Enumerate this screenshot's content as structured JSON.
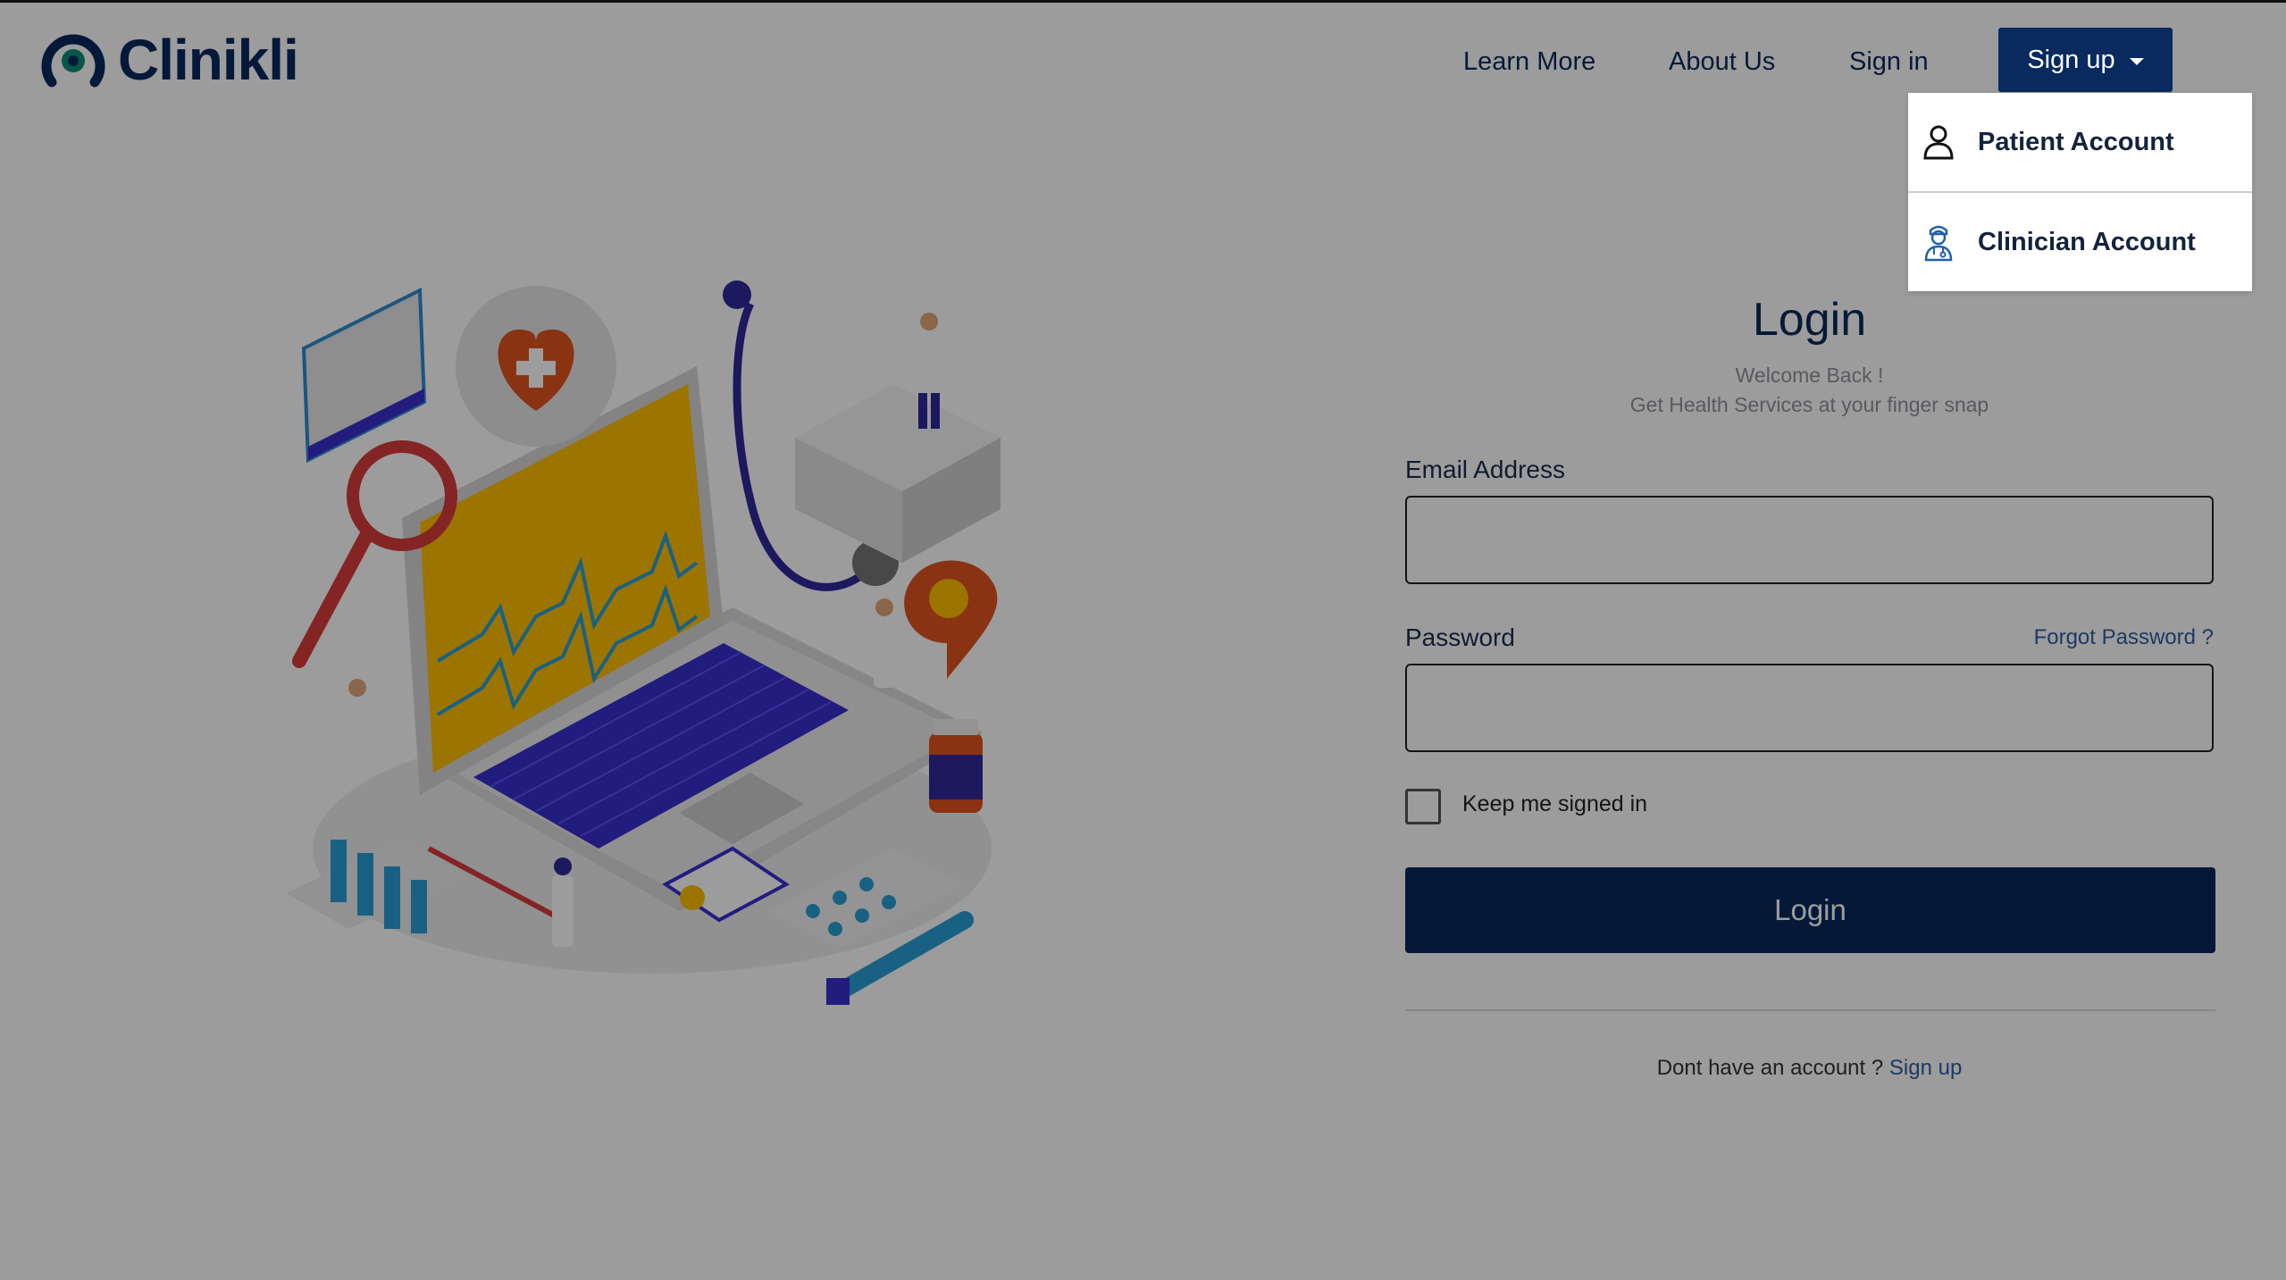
{
  "brand": {
    "name": "Clinikli",
    "primary_color": "#082a5e",
    "link_color": "#2e5fa4",
    "overlay_color": "rgba(0,0,0,0.39)"
  },
  "nav": {
    "learn_more": "Learn More",
    "about_us": "About Us",
    "sign_in": "Sign in",
    "sign_up": "Sign up"
  },
  "dropdown": {
    "items": [
      {
        "label": "Patient Account",
        "icon": "person-outline-icon"
      },
      {
        "label": "Clinician Account",
        "icon": "doctor-icon"
      }
    ]
  },
  "login": {
    "title": "Login",
    "welcome_line1": "Welcome Back !",
    "welcome_line2": "Get Health Services at your finger snap",
    "email_label": "Email Address",
    "email_value": "",
    "password_label": "Password",
    "password_value": "",
    "forgot_password": "Forgot Password ?",
    "keep_signed_in": "Keep me signed in",
    "keep_signed_in_checked": false,
    "submit": "Login",
    "no_account_text": "Dont have an account ?",
    "sign_up_link": "Sign up"
  },
  "illustration": {
    "icon": "medical-laptop-illustration"
  }
}
